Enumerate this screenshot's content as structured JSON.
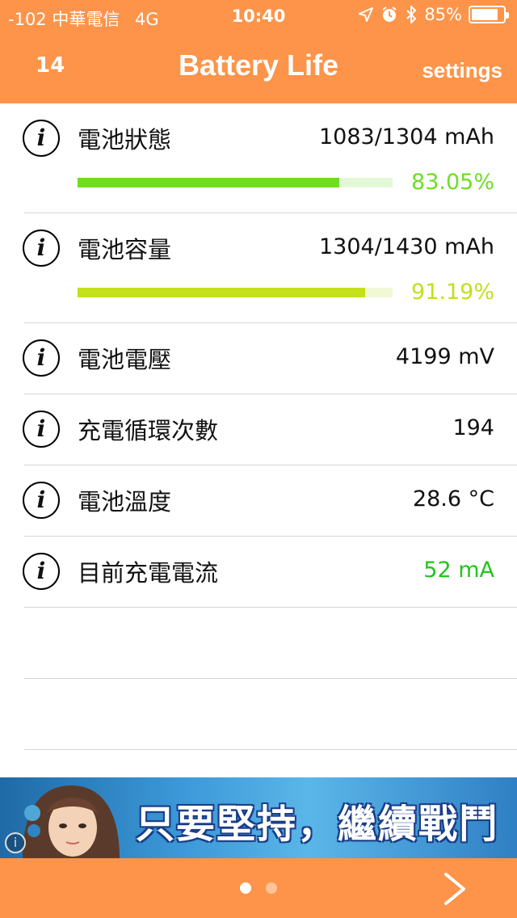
{
  "status_bar": {
    "carrier": "-102 中華電信",
    "network": "4G",
    "time": "10:40",
    "battery_text": "85%",
    "battery_level": 0.85
  },
  "nav": {
    "left_label": "14",
    "title": "Battery Life",
    "settings_label": "settings"
  },
  "rows": [
    {
      "label": "電池狀態",
      "value": "1083/1304 mAh",
      "percent_text": "83.05%",
      "percent": 83.05,
      "bar_color": "#6fde22",
      "bar_track": "#e2f8d6",
      "pct_color": "#6fde22"
    },
    {
      "label": "電池容量",
      "value": "1304/1430 mAh",
      "percent_text": "91.19%",
      "percent": 91.19,
      "bar_color": "#c3e01a",
      "bar_track": "#f1f8d6",
      "pct_color": "#c3e01a"
    },
    {
      "label": "電池電壓",
      "value": "4199 mV"
    },
    {
      "label": "充電循環次數",
      "value": "194"
    },
    {
      "label": "電池溫度",
      "value": "28.6 °C"
    },
    {
      "label": "目前充電電流",
      "value": "52 mA",
      "value_color": "#22c41e"
    }
  ],
  "ad_banner": {
    "text": "只要堅持，繼續戰鬥"
  },
  "pager": {
    "current_page": 1,
    "page_count": 2
  },
  "colors": {
    "accent": "#fd944a",
    "divider": "#d6d6d6"
  },
  "icons": {
    "info": "info-icon",
    "next": "chevron-right-icon",
    "location": "location-arrow-icon",
    "alarm": "alarm-icon",
    "bluetooth": "bluetooth-icon"
  }
}
